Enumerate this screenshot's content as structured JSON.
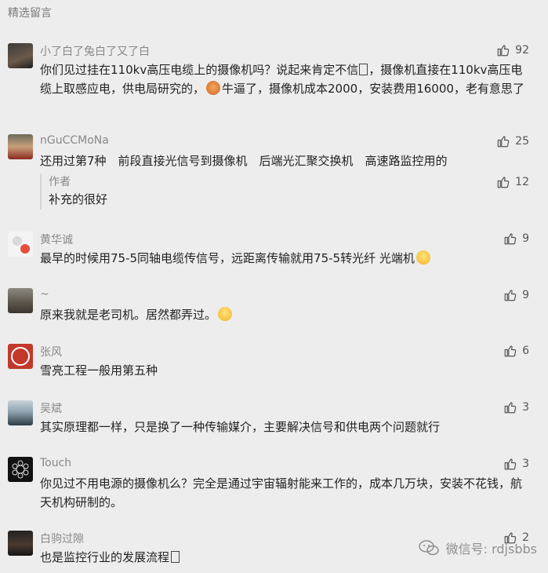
{
  "section_title": "精选留言",
  "comments": [
    {
      "name": "小了白了兔白了又了白",
      "likes": "92",
      "text_a": "你们见过挂在110kv高压电缆上的摄像机吗？说起来肯定不信",
      "text_b": "，摄像机直接在110kv高压电缆上取感应电，供电局研究的，",
      "text_c": "牛逼了，摄像机成本2000，安装费用16000，老有意思了"
    },
    {
      "name": "nGuCCMoNa",
      "likes": "25",
      "text": "还用过第7种　前段直接光信号到摄像机　后端光汇聚交换机　高速路监控用的",
      "reply": {
        "name": "作者",
        "likes": "12",
        "text": "补充的很好"
      }
    },
    {
      "name": "黄华诚",
      "likes": "9",
      "text": "最早的时候用75-5同轴电缆传信号，远距离传输就用75-5转光纤 光端机"
    },
    {
      "name": "~",
      "likes": "9",
      "text": "原来我就是老司机。居然都弄过。"
    },
    {
      "name": "张风",
      "likes": "6",
      "text": "雪亮工程一般用第五种"
    },
    {
      "name": "吴斌",
      "likes": "3",
      "text": "其实原理都一样，只是换了一种传输媒介，主要解决信号和供电两个问题就行"
    },
    {
      "name": "Touch",
      "likes": "3",
      "text": "你见过不用电源的摄像机么？完全是通过宇宙辐射能来工作的，成本几万块，安装不花钱，航天机构研制的。"
    },
    {
      "name": "白驹过隙",
      "likes": "2",
      "text": "也是监控行业的发展流程"
    }
  ],
  "watermark": "微信号: rdjsbbs",
  "colors": {
    "background": "#ededed",
    "text": "#222222",
    "meta": "#888888"
  }
}
